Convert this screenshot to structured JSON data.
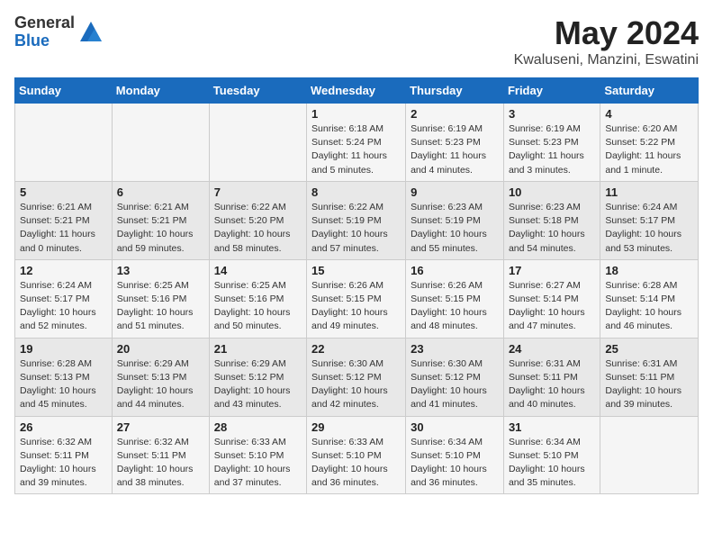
{
  "logo": {
    "general": "General",
    "blue": "Blue"
  },
  "title": {
    "month_year": "May 2024",
    "location": "Kwaluseni, Manzini, Eswatini"
  },
  "headers": [
    "Sunday",
    "Monday",
    "Tuesday",
    "Wednesday",
    "Thursday",
    "Friday",
    "Saturday"
  ],
  "weeks": [
    [
      {
        "day": "",
        "info": ""
      },
      {
        "day": "",
        "info": ""
      },
      {
        "day": "",
        "info": ""
      },
      {
        "day": "1",
        "info": "Sunrise: 6:18 AM\nSunset: 5:24 PM\nDaylight: 11 hours\nand 5 minutes."
      },
      {
        "day": "2",
        "info": "Sunrise: 6:19 AM\nSunset: 5:23 PM\nDaylight: 11 hours\nand 4 minutes."
      },
      {
        "day": "3",
        "info": "Sunrise: 6:19 AM\nSunset: 5:23 PM\nDaylight: 11 hours\nand 3 minutes."
      },
      {
        "day": "4",
        "info": "Sunrise: 6:20 AM\nSunset: 5:22 PM\nDaylight: 11 hours\nand 1 minute."
      }
    ],
    [
      {
        "day": "5",
        "info": "Sunrise: 6:21 AM\nSunset: 5:21 PM\nDaylight: 11 hours\nand 0 minutes."
      },
      {
        "day": "6",
        "info": "Sunrise: 6:21 AM\nSunset: 5:21 PM\nDaylight: 10 hours\nand 59 minutes."
      },
      {
        "day": "7",
        "info": "Sunrise: 6:22 AM\nSunset: 5:20 PM\nDaylight: 10 hours\nand 58 minutes."
      },
      {
        "day": "8",
        "info": "Sunrise: 6:22 AM\nSunset: 5:19 PM\nDaylight: 10 hours\nand 57 minutes."
      },
      {
        "day": "9",
        "info": "Sunrise: 6:23 AM\nSunset: 5:19 PM\nDaylight: 10 hours\nand 55 minutes."
      },
      {
        "day": "10",
        "info": "Sunrise: 6:23 AM\nSunset: 5:18 PM\nDaylight: 10 hours\nand 54 minutes."
      },
      {
        "day": "11",
        "info": "Sunrise: 6:24 AM\nSunset: 5:17 PM\nDaylight: 10 hours\nand 53 minutes."
      }
    ],
    [
      {
        "day": "12",
        "info": "Sunrise: 6:24 AM\nSunset: 5:17 PM\nDaylight: 10 hours\nand 52 minutes."
      },
      {
        "day": "13",
        "info": "Sunrise: 6:25 AM\nSunset: 5:16 PM\nDaylight: 10 hours\nand 51 minutes."
      },
      {
        "day": "14",
        "info": "Sunrise: 6:25 AM\nSunset: 5:16 PM\nDaylight: 10 hours\nand 50 minutes."
      },
      {
        "day": "15",
        "info": "Sunrise: 6:26 AM\nSunset: 5:15 PM\nDaylight: 10 hours\nand 49 minutes."
      },
      {
        "day": "16",
        "info": "Sunrise: 6:26 AM\nSunset: 5:15 PM\nDaylight: 10 hours\nand 48 minutes."
      },
      {
        "day": "17",
        "info": "Sunrise: 6:27 AM\nSunset: 5:14 PM\nDaylight: 10 hours\nand 47 minutes."
      },
      {
        "day": "18",
        "info": "Sunrise: 6:28 AM\nSunset: 5:14 PM\nDaylight: 10 hours\nand 46 minutes."
      }
    ],
    [
      {
        "day": "19",
        "info": "Sunrise: 6:28 AM\nSunset: 5:13 PM\nDaylight: 10 hours\nand 45 minutes."
      },
      {
        "day": "20",
        "info": "Sunrise: 6:29 AM\nSunset: 5:13 PM\nDaylight: 10 hours\nand 44 minutes."
      },
      {
        "day": "21",
        "info": "Sunrise: 6:29 AM\nSunset: 5:12 PM\nDaylight: 10 hours\nand 43 minutes."
      },
      {
        "day": "22",
        "info": "Sunrise: 6:30 AM\nSunset: 5:12 PM\nDaylight: 10 hours\nand 42 minutes."
      },
      {
        "day": "23",
        "info": "Sunrise: 6:30 AM\nSunset: 5:12 PM\nDaylight: 10 hours\nand 41 minutes."
      },
      {
        "day": "24",
        "info": "Sunrise: 6:31 AM\nSunset: 5:11 PM\nDaylight: 10 hours\nand 40 minutes."
      },
      {
        "day": "25",
        "info": "Sunrise: 6:31 AM\nSunset: 5:11 PM\nDaylight: 10 hours\nand 39 minutes."
      }
    ],
    [
      {
        "day": "26",
        "info": "Sunrise: 6:32 AM\nSunset: 5:11 PM\nDaylight: 10 hours\nand 39 minutes."
      },
      {
        "day": "27",
        "info": "Sunrise: 6:32 AM\nSunset: 5:11 PM\nDaylight: 10 hours\nand 38 minutes."
      },
      {
        "day": "28",
        "info": "Sunrise: 6:33 AM\nSunset: 5:10 PM\nDaylight: 10 hours\nand 37 minutes."
      },
      {
        "day": "29",
        "info": "Sunrise: 6:33 AM\nSunset: 5:10 PM\nDaylight: 10 hours\nand 36 minutes."
      },
      {
        "day": "30",
        "info": "Sunrise: 6:34 AM\nSunset: 5:10 PM\nDaylight: 10 hours\nand 36 minutes."
      },
      {
        "day": "31",
        "info": "Sunrise: 6:34 AM\nSunset: 5:10 PM\nDaylight: 10 hours\nand 35 minutes."
      },
      {
        "day": "",
        "info": ""
      }
    ]
  ]
}
